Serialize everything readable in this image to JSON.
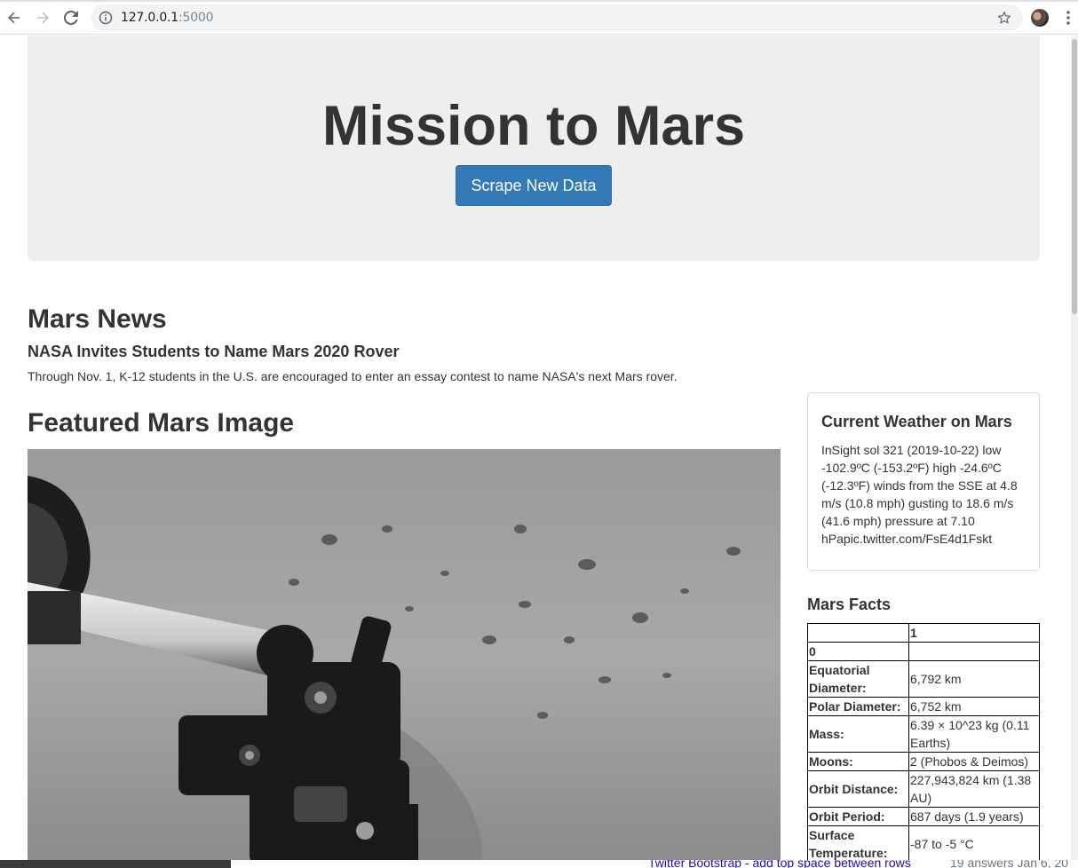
{
  "browser": {
    "url_host": "127.0.0.1",
    "url_port": ":5000"
  },
  "jumbotron": {
    "title": "Mission to Mars",
    "scrape_button": "Scrape New Data"
  },
  "news": {
    "section_title": "Mars News",
    "headline": "NASA Invites Students to Name Mars 2020 Rover",
    "teaser": "Through Nov. 1, K-12 students in the U.S. are encouraged to enter an essay contest to name NASA's next Mars rover."
  },
  "featured": {
    "section_title": "Featured Mars Image"
  },
  "weather": {
    "title": "Current Weather on Mars",
    "text": "InSight sol 321 (2019-10-22) low -102.9ºC (-153.2ºF) high -24.6ºC (-12.3ºF) winds from the SSE at 4.8 m/s (10.8 mph) gusting to 18.6 m/s (41.6 mph) pressure at 7.10 hPapic.twitter.com/FsE4d1Fskt"
  },
  "facts": {
    "title": "Mars Facts",
    "header": [
      "",
      "1"
    ],
    "index_row": [
      "0",
      ""
    ],
    "rows": [
      [
        "Equatorial Diameter:",
        "6,792 km"
      ],
      [
        "Polar Diameter:",
        "6,752 km"
      ],
      [
        "Mass:",
        "6.39 × 10^23 kg (0.11 Earths)"
      ],
      [
        "Moons:",
        "2 (Phobos & Deimos)"
      ],
      [
        "Orbit Distance:",
        "227,943,824 km (1.38 AU)"
      ],
      [
        "Orbit Period:",
        "687 days (1.9 years)"
      ],
      [
        "Surface Temperature:",
        "-87 to -5 °C"
      ]
    ]
  },
  "background_snippet": {
    "link": "Twitter Bootstrap - add top space between rows",
    "meta": "19 answers   Jan 6, 20"
  },
  "icons": {
    "back": "back-arrow-icon",
    "forward": "forward-arrow-icon",
    "reload": "reload-icon",
    "info": "info-icon",
    "star": "bookmark-star-icon",
    "menu": "menu-dots-icon"
  }
}
